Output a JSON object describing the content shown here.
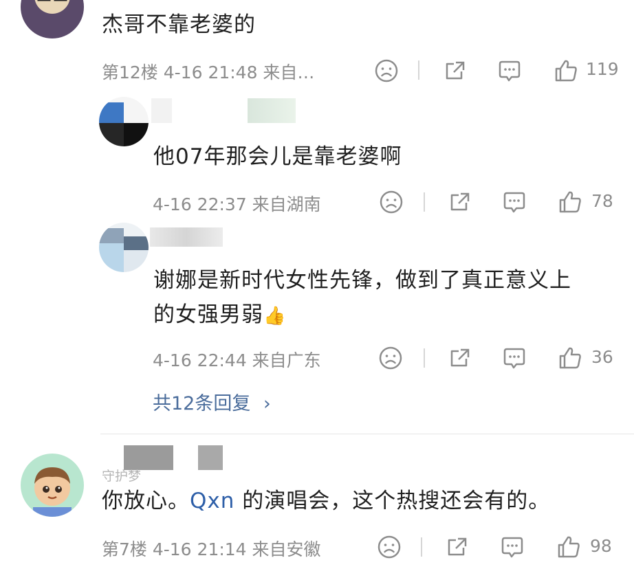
{
  "comments": [
    {
      "text": "杰哥不靠老婆的",
      "meta": "第12楼 4-16 21:48 来自…",
      "likes": "119"
    },
    {
      "text": "他07年那会儿是靠老婆啊",
      "meta": "4-16 22:37 来自湖南",
      "likes": "78"
    },
    {
      "text_line1": "谢娜是新时代女性先锋，做到了真正意义上",
      "text_line2": "的女强男弱",
      "emoji": "👍",
      "meta": "4-16 22:44 来自广东",
      "likes": "36"
    },
    {
      "replies_link": "共12条回复",
      "replies_chevron": "›"
    },
    {
      "username_partial": "守护梦",
      "text_before": "你放心。",
      "search_term": "Qxn",
      "text_after": " 的演唱会，这个热搜还会有的。",
      "meta": "第7楼 4-16 21:14 来自安徽",
      "likes": "98"
    }
  ],
  "icons": {
    "dislike": "sad-face-icon",
    "share": "share-icon",
    "comment": "comment-icon",
    "like": "thumbs-up-icon"
  },
  "colors": {
    "meta_gray": "#8c8c8c",
    "link_blue": "#4a6c9b"
  }
}
